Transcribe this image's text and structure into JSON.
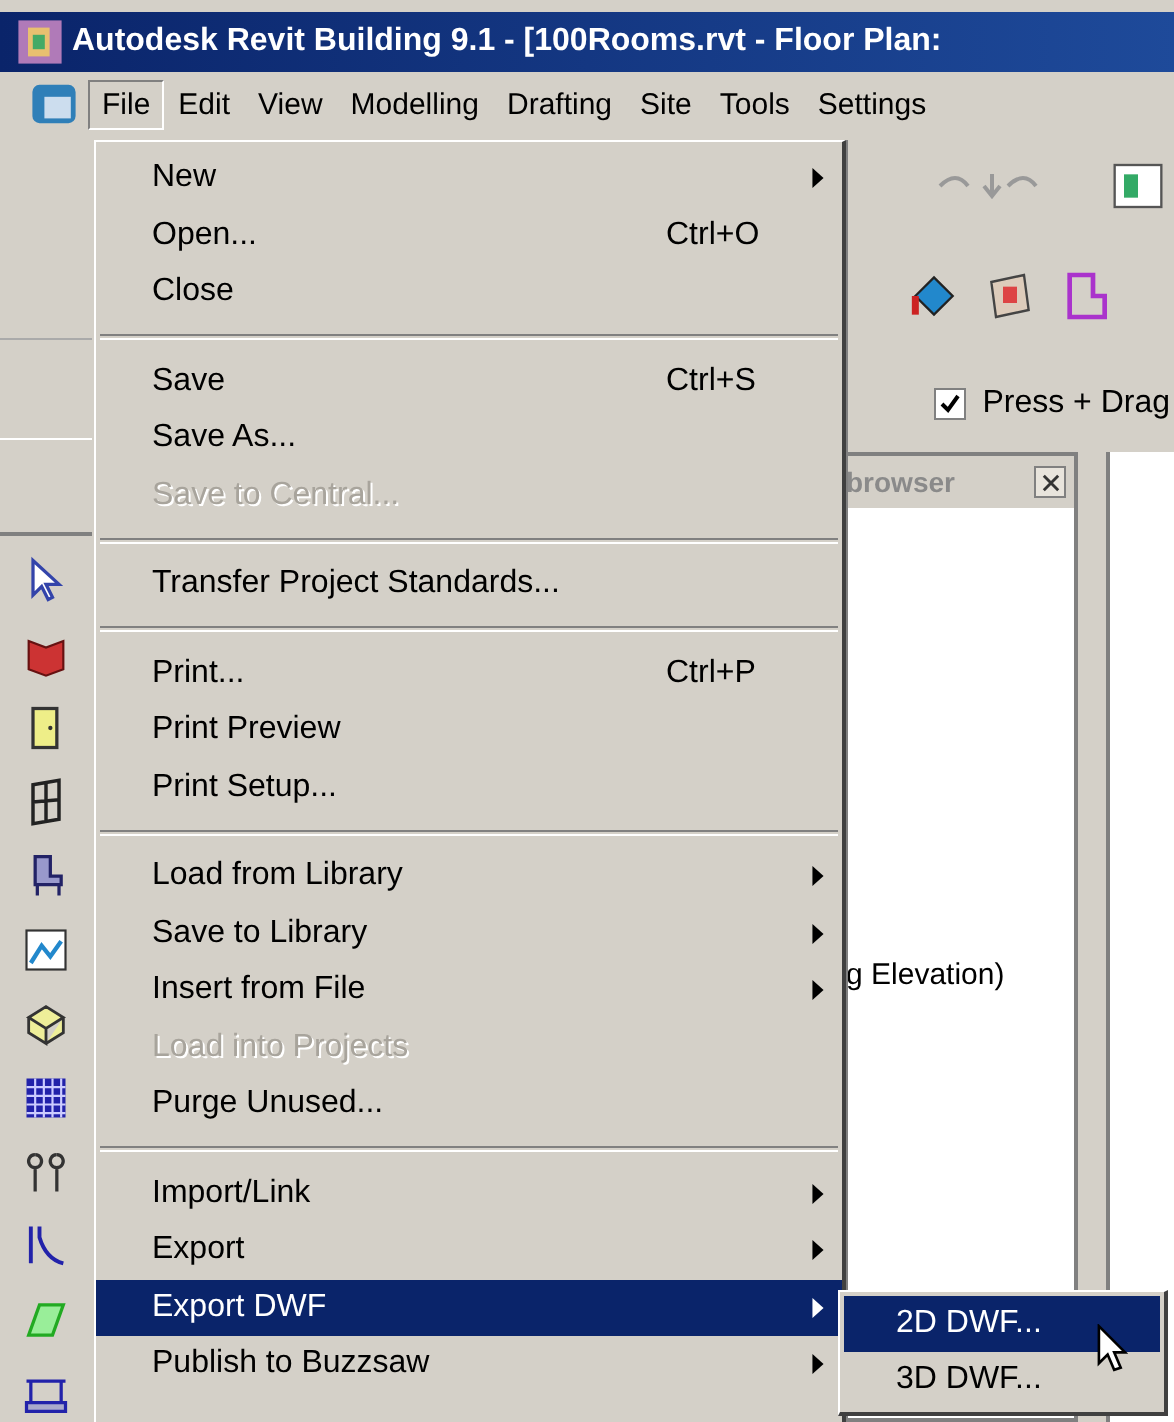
{
  "window": {
    "title": "Autodesk Revit Building 9.1 - [100Rooms.rvt - Floor Plan:"
  },
  "menubar": {
    "items": [
      {
        "label": "File",
        "selected": true
      },
      {
        "label": "Edit",
        "selected": false
      },
      {
        "label": "View",
        "selected": false
      },
      {
        "label": "Modelling",
        "selected": false
      },
      {
        "label": "Drafting",
        "selected": false
      },
      {
        "label": "Site",
        "selected": false
      },
      {
        "label": "Tools",
        "selected": false
      },
      {
        "label": "Settings",
        "selected": false
      }
    ]
  },
  "toolbar": {
    "checkbox": {
      "label": "Press + Drag",
      "checked": true
    }
  },
  "browser": {
    "title": "browser",
    "text": "g Elevation)"
  },
  "file_menu": {
    "items": [
      {
        "kind": "item",
        "label": "New",
        "has_submenu": true,
        "disabled": false,
        "selected": false
      },
      {
        "kind": "item",
        "label": "Open...",
        "shortcut": "Ctrl+O",
        "has_submenu": false,
        "disabled": false,
        "selected": false
      },
      {
        "kind": "item",
        "label": "Close",
        "has_submenu": false,
        "disabled": false,
        "selected": false
      },
      {
        "kind": "separator"
      },
      {
        "kind": "item",
        "label": "Save",
        "shortcut": "Ctrl+S",
        "has_submenu": false,
        "disabled": false,
        "selected": false
      },
      {
        "kind": "item",
        "label": "Save As...",
        "has_submenu": false,
        "disabled": false,
        "selected": false
      },
      {
        "kind": "item",
        "label": "Save to Central...",
        "has_submenu": false,
        "disabled": true,
        "selected": false
      },
      {
        "kind": "separator"
      },
      {
        "kind": "item",
        "label": "Transfer Project Standards...",
        "has_submenu": false,
        "disabled": false,
        "selected": false
      },
      {
        "kind": "separator"
      },
      {
        "kind": "item",
        "label": "Print...",
        "shortcut": "Ctrl+P",
        "has_submenu": false,
        "disabled": false,
        "selected": false
      },
      {
        "kind": "item",
        "label": "Print Preview",
        "has_submenu": false,
        "disabled": false,
        "selected": false
      },
      {
        "kind": "item",
        "label": "Print Setup...",
        "has_submenu": false,
        "disabled": false,
        "selected": false
      },
      {
        "kind": "separator"
      },
      {
        "kind": "item",
        "label": "Load from Library",
        "has_submenu": true,
        "disabled": false,
        "selected": false
      },
      {
        "kind": "item",
        "label": "Save to Library",
        "has_submenu": true,
        "disabled": false,
        "selected": false
      },
      {
        "kind": "item",
        "label": "Insert from File",
        "has_submenu": true,
        "disabled": false,
        "selected": false
      },
      {
        "kind": "item",
        "label": "Load into Projects",
        "has_submenu": false,
        "disabled": true,
        "selected": false
      },
      {
        "kind": "item",
        "label": "Purge Unused...",
        "has_submenu": false,
        "disabled": false,
        "selected": false
      },
      {
        "kind": "separator"
      },
      {
        "kind": "item",
        "label": "Import/Link",
        "has_submenu": true,
        "disabled": false,
        "selected": false
      },
      {
        "kind": "item",
        "label": "Export",
        "has_submenu": true,
        "disabled": false,
        "selected": false
      },
      {
        "kind": "item",
        "label": "Export DWF",
        "has_submenu": true,
        "disabled": false,
        "selected": true
      },
      {
        "kind": "item",
        "label": "Publish to Buzzsaw",
        "has_submenu": true,
        "disabled": false,
        "selected": false
      }
    ]
  },
  "submenu": {
    "items": [
      {
        "label": "2D DWF...",
        "selected": true
      },
      {
        "label": "3D DWF...",
        "selected": false
      }
    ]
  }
}
